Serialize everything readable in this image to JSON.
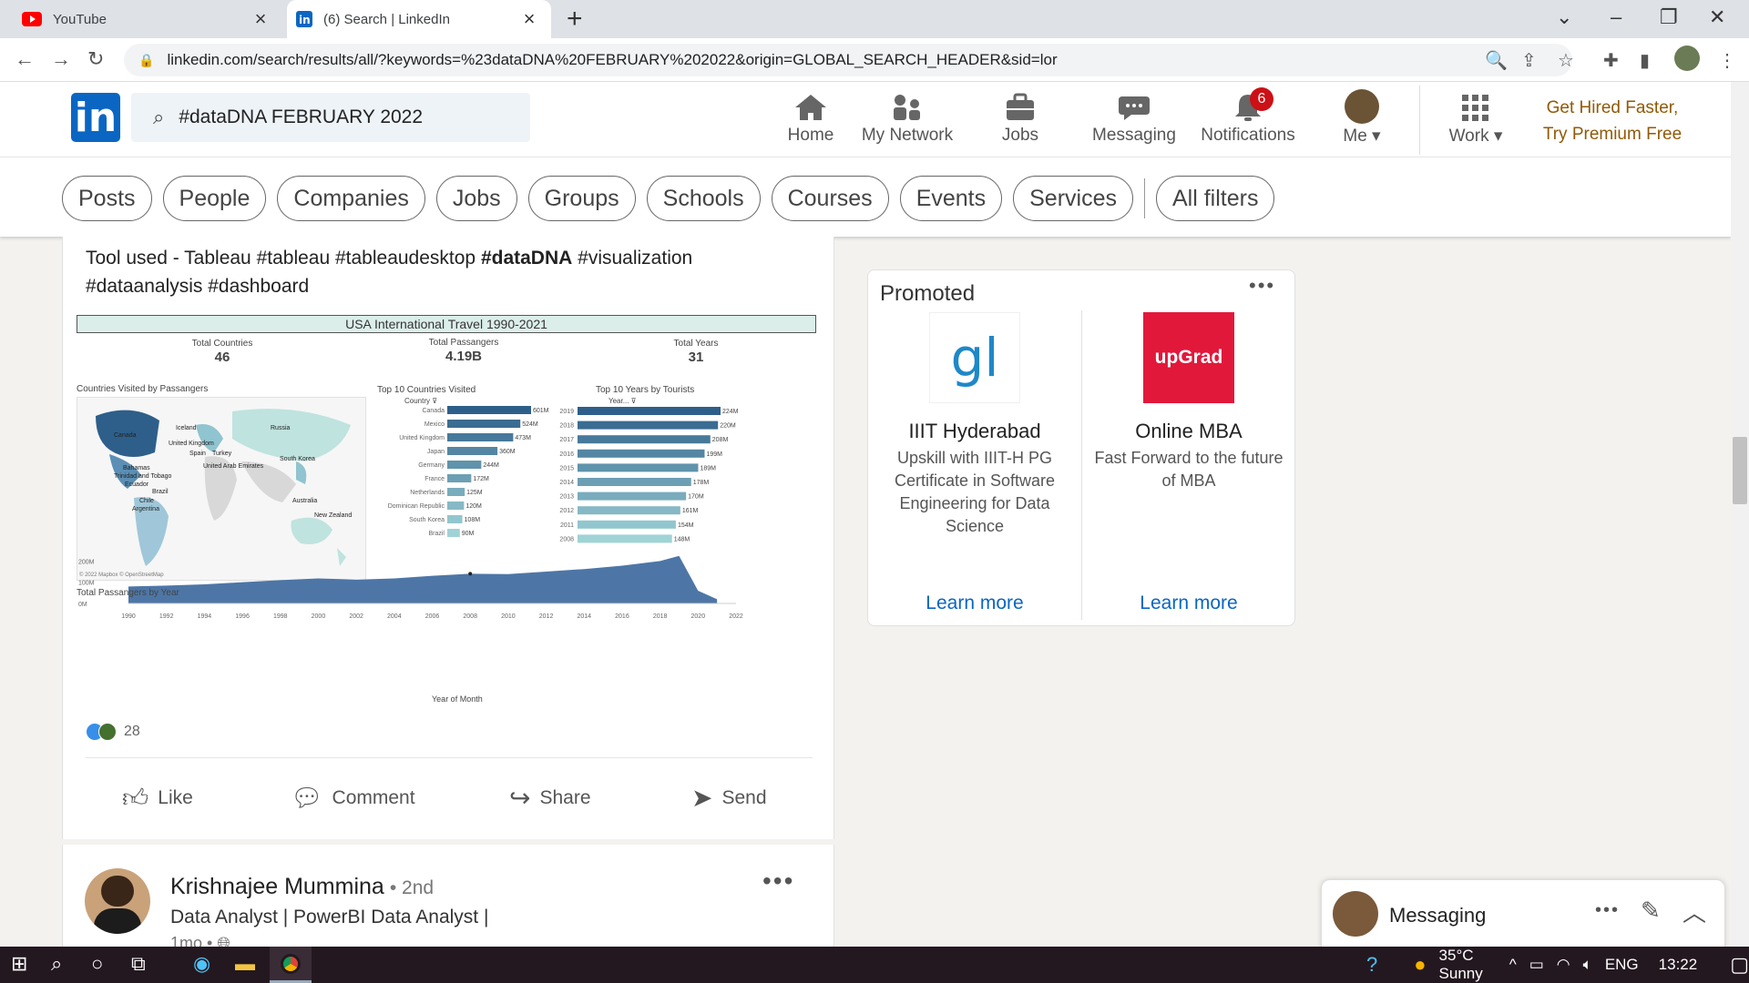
{
  "browser": {
    "tabs": [
      {
        "title": "YouTube",
        "icon": "youtube-icon"
      },
      {
        "title": "(6) Search | LinkedIn",
        "icon": "linkedin-icon"
      }
    ],
    "url": "linkedin.com/search/results/all/?keywords=%23dataDNA%20FEBRUARY%202022&origin=GLOBAL_SEARCH_HEADER&sid=lor"
  },
  "header": {
    "search_value": "#dataDNA FEBRUARY 2022",
    "nav": [
      {
        "label": "Home"
      },
      {
        "label": "My Network"
      },
      {
        "label": "Jobs"
      },
      {
        "label": "Messaging"
      },
      {
        "label": "Notifications"
      },
      {
        "label": "Me"
      },
      {
        "label": "Work"
      }
    ],
    "notifications_count": "6",
    "premium_line1": "Get Hired Faster,",
    "premium_line2": "Try Premium Free"
  },
  "filters": [
    "Posts",
    "People",
    "Companies",
    "Jobs",
    "Groups",
    "Schools",
    "Courses",
    "Events",
    "Services",
    "All filters"
  ],
  "post": {
    "text_line1": "Tool used - Tableau #tableau #tableaudesktop ",
    "text_bold": "#dataDNA",
    "text_line1_end": " #visualization",
    "text_line2": "#dataanalysis #dashboard",
    "reaction_count": "28",
    "actions": [
      "Like",
      "Comment",
      "Share",
      "Send"
    ]
  },
  "dashboard": {
    "title": "USA International Travel 1990-2021",
    "kpis": [
      {
        "label": "Total Countries",
        "value": "46"
      },
      {
        "label": "Total Passangers",
        "value": "4.19B"
      },
      {
        "label": "Total Years",
        "value": "31"
      }
    ],
    "map_title": "Countries Visited by Passangers",
    "map_credit": "© 2022 Mapbox © OpenStreetMap",
    "map_labels": [
      "Canada",
      "Iceland",
      "Russia",
      "United Kingdom",
      "Spain",
      "Turkey",
      "South Korea",
      "United Arab Emirates",
      "Bahamas",
      "Trinidad and Tobago",
      "Ecuador",
      "Brazil",
      "Chile",
      "Argentina",
      "Australia",
      "New Zealand"
    ]
  },
  "chart_data": [
    {
      "type": "bar",
      "title": "Top 10 Countries Visited",
      "xlabel": "",
      "ylabel": "Country",
      "categories": [
        "Canada",
        "Mexico",
        "United Kingdom",
        "Japan",
        "Germany",
        "France",
        "Netherlands",
        "Dominican Republic",
        "South Korea",
        "Brazil"
      ],
      "values": [
        601,
        524,
        473,
        360,
        244,
        172,
        125,
        120,
        108,
        90
      ],
      "labels": [
        "601M",
        "524M",
        "473M",
        "360M",
        "244M",
        "172M",
        "125M",
        "120M",
        "108M",
        "90M"
      ],
      "orientation": "horizontal"
    },
    {
      "type": "bar",
      "title": "Top 10 Years by Tourists",
      "xlabel": "",
      "ylabel": "Year",
      "categories": [
        "2019",
        "2018",
        "2017",
        "2016",
        "2015",
        "2014",
        "2013",
        "2012",
        "2011",
        "2008"
      ],
      "values": [
        224,
        220,
        208,
        199,
        189,
        178,
        170,
        161,
        154,
        148
      ],
      "labels": [
        "224M",
        "220M",
        "208M",
        "199M",
        "189M",
        "178M",
        "170M",
        "161M",
        "154M",
        "148M"
      ],
      "orientation": "horizontal"
    },
    {
      "type": "area",
      "title": "Total Passangers by Year",
      "xlabel": "Year of Month",
      "ylabel": "",
      "x": [
        1990,
        1992,
        1994,
        1996,
        1998,
        2000,
        2002,
        2004,
        2006,
        2008,
        2010,
        2012,
        2014,
        2016,
        2018,
        2019,
        2020,
        2021
      ],
      "values": [
        80,
        84,
        90,
        100,
        110,
        118,
        112,
        118,
        130,
        140,
        138,
        150,
        162,
        178,
        200,
        224,
        60,
        20
      ],
      "xticks": [
        "1990",
        "1992",
        "1994",
        "1996",
        "1998",
        "2000",
        "2002",
        "2004",
        "2006",
        "2008",
        "2010",
        "2012",
        "2014",
        "2016",
        "2018",
        "2020",
        "2022"
      ],
      "yticks": [
        "200M",
        "100M",
        "0M"
      ],
      "ylim": [
        0,
        240
      ],
      "xlim": [
        1990,
        2022
      ]
    }
  ],
  "next_post": {
    "name": "Krishnajee Mummina",
    "degree": "• 2nd",
    "headline": "Data Analyst | PowerBI Data Analyst |",
    "time": "1mo •"
  },
  "promo": {
    "label": "Promoted",
    "ads": [
      {
        "logo": "gl",
        "title": "IIIT Hyderabad",
        "desc": "Upskill with IIIT-H PG Certificate in Software Engineering for Data Science",
        "cta": "Learn more"
      },
      {
        "logo": "upGrad",
        "title": "Online MBA",
        "desc": "Fast Forward to the future of MBA",
        "cta": "Learn more"
      }
    ]
  },
  "messaging": {
    "title": "Messaging"
  },
  "taskbar": {
    "weather": "35°C  Sunny",
    "lang": "ENG",
    "time": "13:22"
  },
  "colors": {
    "linkedin_blue": "#0a66c2",
    "premium_gold": "#915907",
    "badge_red": "#cc1016",
    "bar_dark": "#2e5f8a",
    "bar_light": "#9fd3d6"
  }
}
